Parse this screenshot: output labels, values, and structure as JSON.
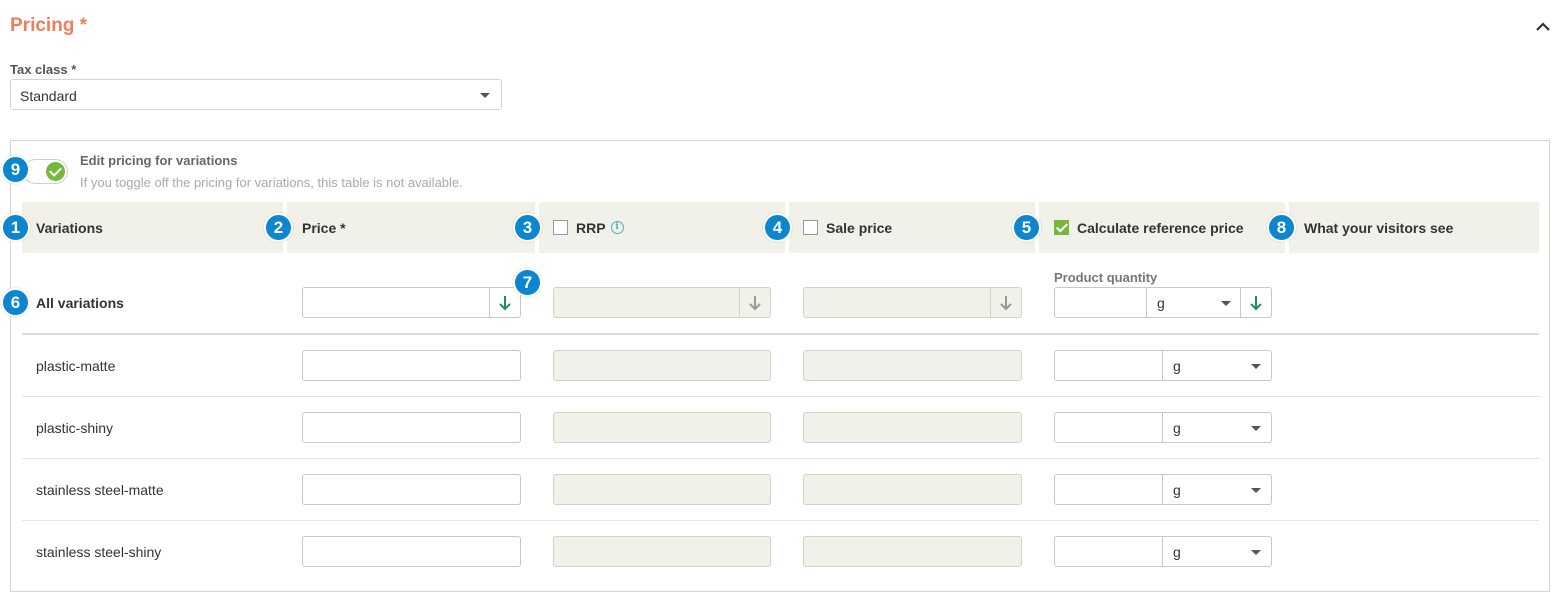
{
  "section": {
    "title": "Pricing *"
  },
  "tax": {
    "label": "Tax class *",
    "value": "Standard"
  },
  "toggle": {
    "label": "Edit pricing for variations",
    "help": "If you toggle off the pricing for variations, this table is not available.",
    "on": true
  },
  "headers": {
    "variations": "Variations",
    "price": "Price *",
    "rrp": "RRP",
    "sale_price": "Sale price",
    "calc_ref": "Calculate reference price",
    "visitors": "What your visitors see"
  },
  "checkboxes": {
    "rrp": false,
    "sale_price": false,
    "calc_ref": true
  },
  "all_variations": {
    "label": "All variations",
    "quantity_label": "Product quantity",
    "unit": "g"
  },
  "rows": [
    {
      "name": "plastic-matte",
      "unit": "g"
    },
    {
      "name": "plastic-shiny",
      "unit": "g"
    },
    {
      "name": "stainless steel-matte",
      "unit": "g"
    },
    {
      "name": "stainless steel-shiny",
      "unit": "g"
    }
  ],
  "badges": [
    "1",
    "2",
    "3",
    "4",
    "5",
    "6",
    "7",
    "8",
    "9"
  ],
  "colors": {
    "accent": "#ef7d5d",
    "badge": "#0b86cf",
    "check_green": "#76b83e",
    "header_bg": "#f1f0e9",
    "apply_arrow": "#1d8a6b"
  },
  "icons": {
    "collapse": "chevron-up-icon",
    "apply": "arrow-down-icon",
    "info": "info-icon",
    "dropdown": "caret-down-icon"
  }
}
